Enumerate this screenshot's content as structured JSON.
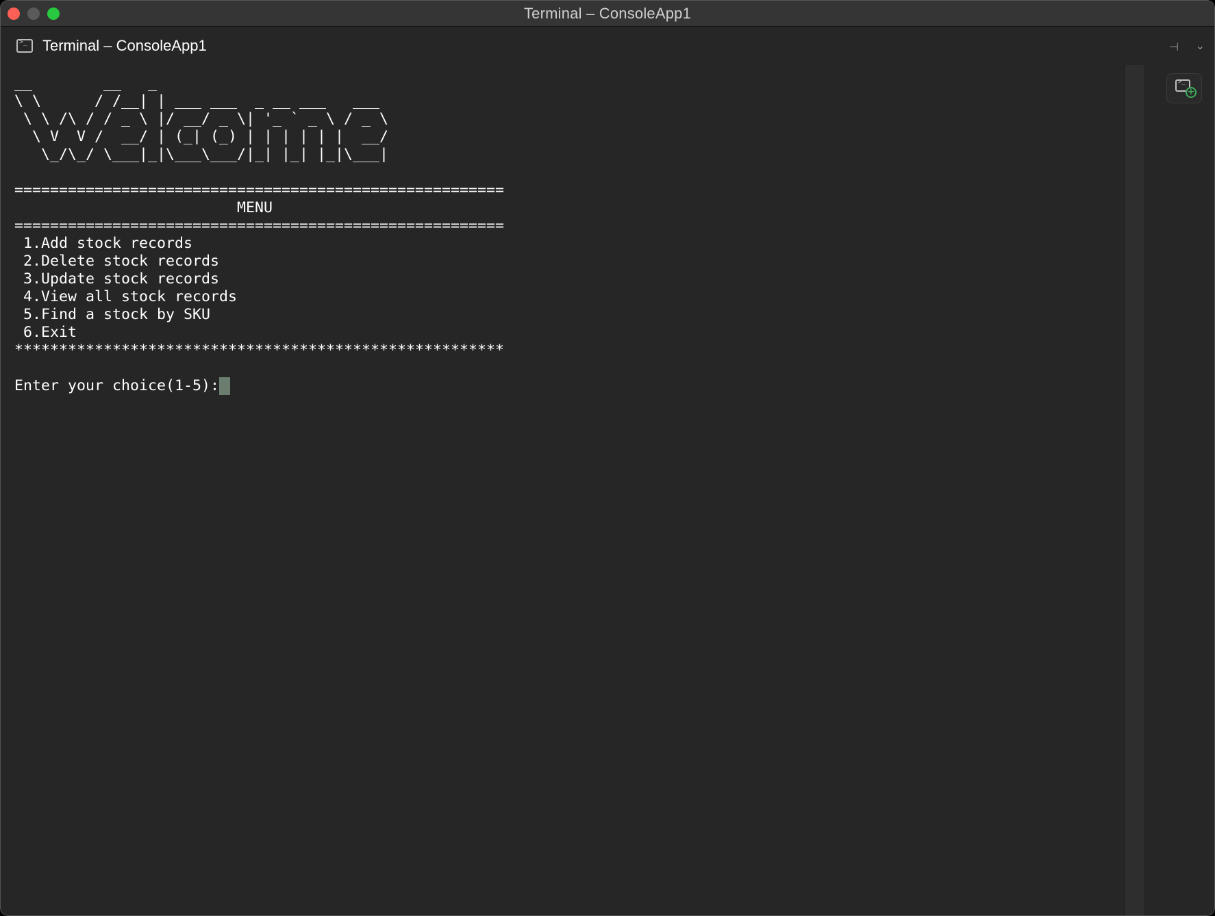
{
  "window": {
    "title": "Terminal – ConsoleApp1"
  },
  "tab": {
    "title": "Terminal – ConsoleApp1",
    "icon": "terminal-icon"
  },
  "toolbar": {
    "pin_icon": "pin-icon",
    "chevron_icon": "chevron-down-icon",
    "new_terminal_icon": "new-terminal-icon"
  },
  "terminal": {
    "banner": [
      "__        __   _",
      "\\ \\      / /__| | ___ ___  _ __ ___   ___",
      " \\ \\ /\\ / / _ \\ |/ __/ _ \\| '_ ` _ \\ / _ \\",
      "  \\ V  V /  __/ | (_| (_) | | | | | |  __/",
      "   \\_/\\_/ \\___|_|\\___\\___/|_| |_| |_|\\___|"
    ],
    "separator_top": "=======================================================",
    "menu_title": "                         MENU",
    "separator_mid": "=======================================================",
    "menu_items": [
      " 1.Add stock records",
      " 2.Delete stock records",
      " 3.Update stock records",
      " 4.View all stock records",
      " 5.Find a stock by SKU",
      " 6.Exit"
    ],
    "separator_bottom": "*******************************************************",
    "prompt": "Enter your choice(1-5):"
  },
  "colors": {
    "background": "#262626",
    "text": "#ffffff",
    "cursor": "#6b7d6e",
    "close": "#fe5f57",
    "zoom": "#28c840"
  }
}
